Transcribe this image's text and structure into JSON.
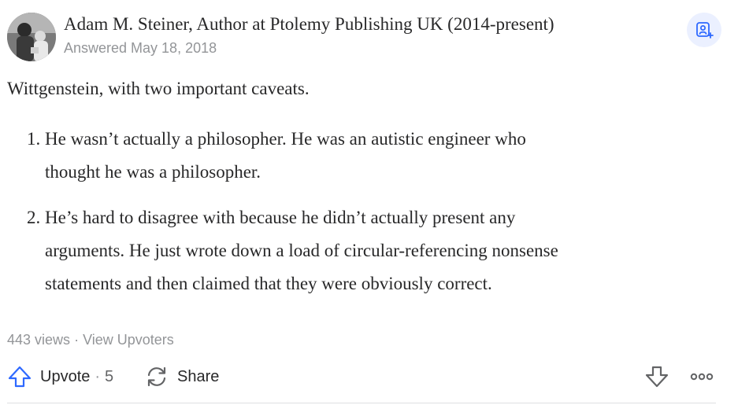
{
  "answer": {
    "author_line": "Adam M. Steiner, Author at Ptolemy Publishing UK (2014-present)",
    "answered_date": "Answered May 18, 2018",
    "intro": "Wittgenstein, with two important caveats.",
    "points": [
      {
        "number": "1.",
        "lines": [
          "He wasn’t actually a philosopher. He was an autistic engineer who",
          "thought he was a philosopher."
        ]
      },
      {
        "number": "2.",
        "lines": [
          "He’s hard to disagree with because he didn’t actually present any",
          "arguments. He just wrote down a load of circular-referencing nonsense",
          "statements and then claimed that they were obviously correct."
        ]
      }
    ]
  },
  "stats": {
    "views": "443 views",
    "separator": "·",
    "view_upvoters": "View Upvoters"
  },
  "actions": {
    "upvote_label": "Upvote",
    "separator": "·",
    "upvote_count": "5",
    "share_label": "Share"
  },
  "colors": {
    "accent_blue": "#2e69ff",
    "follow_bg": "#ebf0ff",
    "meta_gray": "#939598",
    "text": "#282829"
  },
  "icons": {
    "follow": "add-person-icon",
    "upvote": "up-arrow-icon",
    "share": "share-cycle-icon",
    "downvote": "down-arrow-icon",
    "more": "more-dots-icon"
  }
}
